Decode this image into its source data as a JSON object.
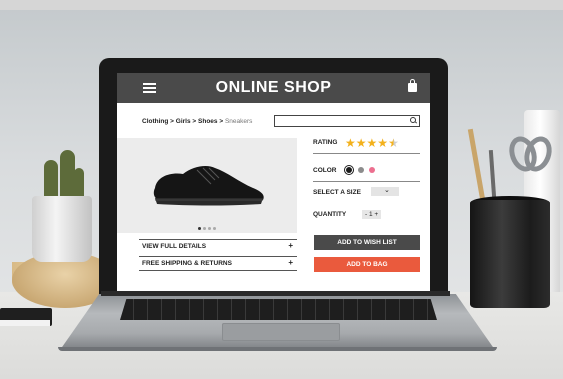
{
  "header": {
    "menu_icon": "hamburger-menu-icon",
    "title": "ONLINE SHOP",
    "cart_icon": "shopping-bag-icon"
  },
  "breadcrumb": {
    "items": [
      "Clothing",
      "Girls",
      "Shoes"
    ],
    "separator": ">",
    "current": "Sneakers"
  },
  "search": {
    "value": "",
    "icon": "search-icon"
  },
  "product": {
    "image_icon": "sneaker-image",
    "carousel": {
      "total": 4,
      "active_index": 0
    }
  },
  "details": {
    "rows": [
      {
        "label": "VIEW FULL DETAILS",
        "icon": "+"
      },
      {
        "label": "FREE SHIPPING & RETURNS",
        "icon": "+"
      }
    ]
  },
  "options": {
    "rating_label": "RATING",
    "rating_value": 4.5,
    "rating_max": 5,
    "color_label": "COLOR",
    "colors": [
      {
        "name": "black",
        "hex": "#1b1b1b",
        "selected": true
      },
      {
        "name": "gray",
        "hex": "#8c8c8c",
        "selected": false
      },
      {
        "name": "pink",
        "hex": "#ec6f8f",
        "selected": false
      }
    ],
    "size_label": "SELECT A SIZE",
    "size_value": "",
    "quantity_label": "QUANTITY",
    "quantity_minus": "-",
    "quantity_value": "1",
    "quantity_plus": "+"
  },
  "actions": {
    "wishlist_label": "ADD TO WISH LIST",
    "bag_label": "ADD TO BAG"
  },
  "colors": {
    "header_bg": "#4a4a4a",
    "accent_orange": "#ea5a3d",
    "star_gold": "#f3b11c"
  }
}
